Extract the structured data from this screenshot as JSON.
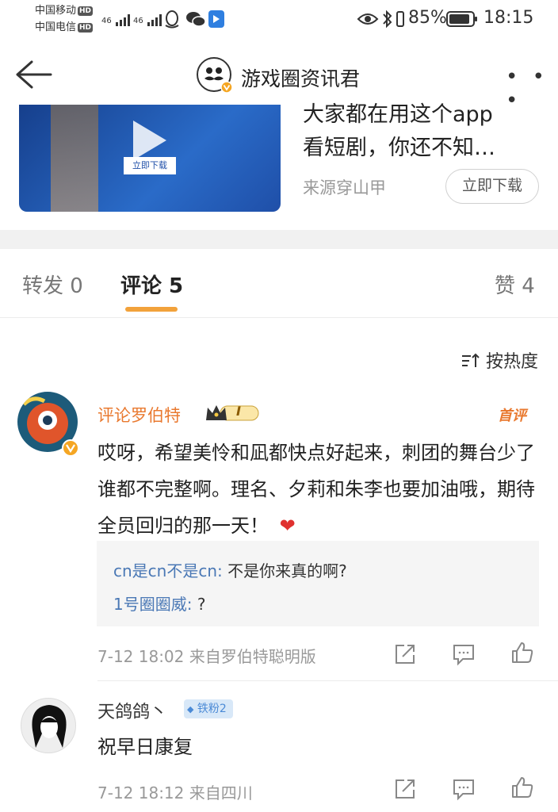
{
  "status_bar": {
    "carrier1": "中国移动",
    "carrier2": "中国电信",
    "hd": "HD",
    "network1": "46",
    "network2": "46",
    "battery": "85%",
    "time": "18:15"
  },
  "header": {
    "title": "游戏圈资讯君",
    "more": "• • •"
  },
  "ad": {
    "text_line1": "大家都在用这个app",
    "text_line2": "看短剧，你还不知…",
    "source": "来源穿山甲",
    "download_label": "立即下载",
    "image_button_label": "立即下载"
  },
  "tabs": {
    "repost": "转发 0",
    "comment": "评论 5",
    "like": "赞 4"
  },
  "sort_label": "按热度",
  "comments": [
    {
      "username": "评论罗伯特",
      "level_badge": "I",
      "first_tag": "首评",
      "text": "哎呀，希望美怜和凪都快点好起来，刺团的舞台少了谁都不完整啊。理名、夕莉和朱李也要加油哦，期待全员回归的那一天！",
      "emoji": "❤",
      "replies": [
        {
          "name": "cn是cn不是cn:",
          "text": " 不是你来真的啊?"
        },
        {
          "name": "1号圈圈威:",
          "text": " ?"
        }
      ],
      "meta": "7-12 18:02  来自罗伯特聪明版"
    },
    {
      "username": "天鸽鸽丶",
      "fan_badge": "铁粉2",
      "text": "祝早日康复",
      "meta": "7-12 18:12  来自四川"
    }
  ],
  "colors": {
    "accent_orange": "#e9792f",
    "tab_underline": "#f2a23b",
    "reply_name": "#4a78b5",
    "fan_badge_bg": "#d8e8f8"
  }
}
